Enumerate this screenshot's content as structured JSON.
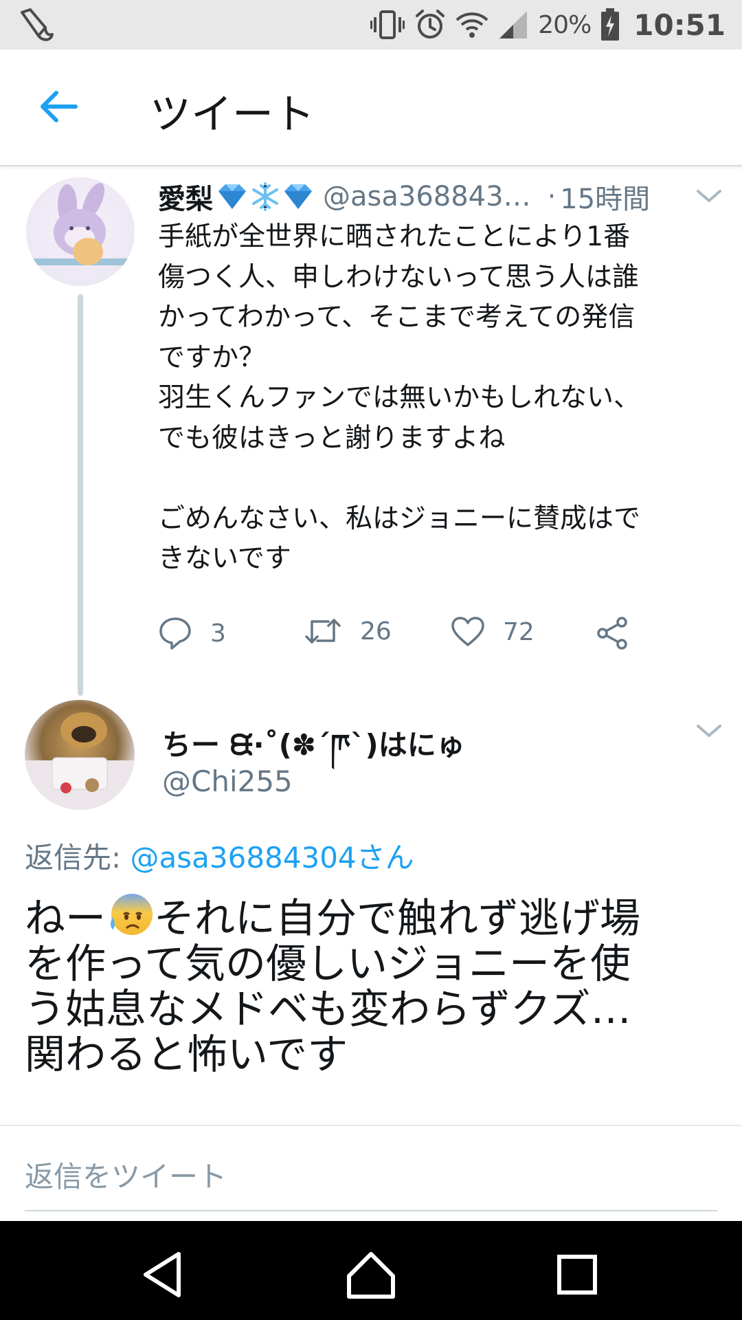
{
  "status_bar": {
    "battery_pct": "20%",
    "time": "10:51",
    "icons": [
      "notification-icon",
      "vibrate-icon",
      "alarm-icon",
      "wifi-icon",
      "signal-icon",
      "battery-charging-icon"
    ]
  },
  "app_bar": {
    "title": "ツイート",
    "back_icon": "back-arrow-icon"
  },
  "parent_tweet": {
    "name": "愛梨",
    "name_emojis": [
      "gem-emoji",
      "snowflake-emoji",
      "gem-emoji"
    ],
    "handle": "@asa368843…",
    "time_sep": "·",
    "time": "15時間",
    "text": "手紙が全世界に晒されたことにより1番\n傷つく人、申しわけないって思う人は誰\nかってわかって、そこまで考えての発信\nですか？\n羽生くんファンでは無いかもしれない、\nでも彼はきっと謝りますよね\n\nごめんなさい、私はジョニーに賛成はで\nきないです",
    "actions": {
      "reply_count": "3",
      "retweet_count": "26",
      "like_count": "72"
    }
  },
  "reply_tweet": {
    "name": "ちー ᙙ·˚(✽´ཫ`)はにゅ",
    "handle": "@Chi255",
    "reply_to_label": "返信先: ",
    "reply_to_handle": "@asa36884304さん",
    "text_part1": "ねー",
    "text_emoji": "anxious-face-with-sweat-emoji",
    "text_part2": "それに自分で触れず逃げ場\nを作って気の優しいジョニーを使\nう姑息なメドベも変わらずクズ…\n関わると怖いです"
  },
  "reply_box": {
    "placeholder": "返信をツイート"
  },
  "colors": {
    "accent": "#1da1f2",
    "secondary_text": "#657786",
    "primary_text": "#14171a",
    "status_bar_bg": "#e8e8e8",
    "nav_bar_bg": "#000000"
  }
}
